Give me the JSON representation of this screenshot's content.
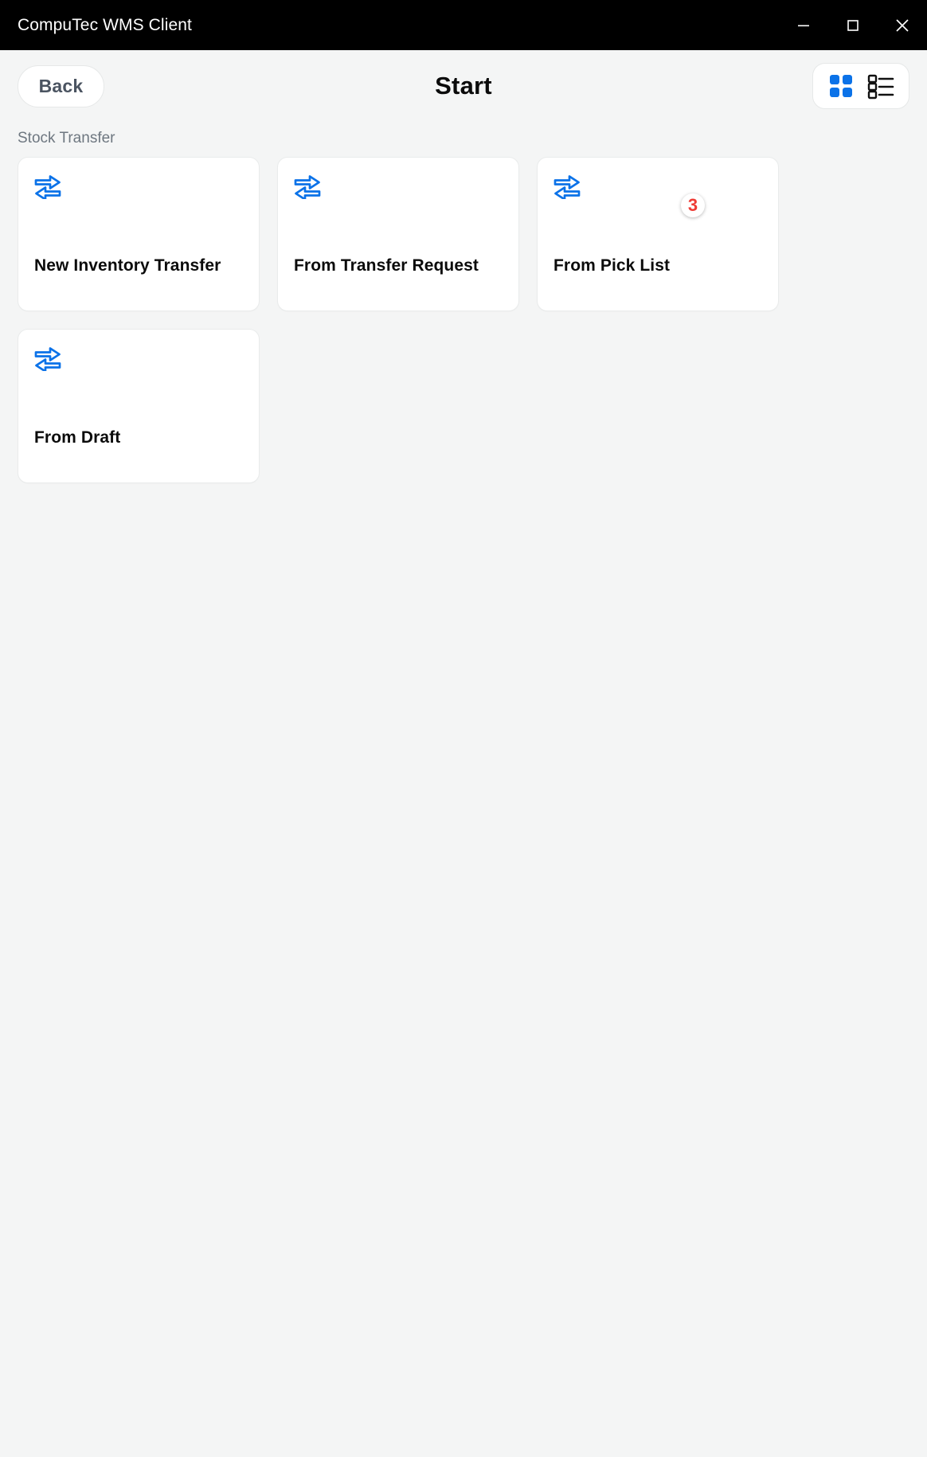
{
  "window": {
    "title": "CompuTec WMS Client",
    "controls": [
      {
        "name": "minimize",
        "icon": "minimize-icon"
      },
      {
        "name": "maximize",
        "icon": "maximize-icon"
      },
      {
        "name": "close",
        "icon": "close-icon"
      }
    ]
  },
  "header": {
    "back_label": "Back",
    "title": "Start",
    "view_toggle": {
      "grid_icon": "grid-view-icon",
      "list_icon": "list-view-icon",
      "active": "grid",
      "active_color": "#0b72e8",
      "inactive_color": "#111111"
    }
  },
  "section": {
    "label": "Stock Transfer"
  },
  "cards": [
    {
      "label": "New Inventory Transfer",
      "icon": "transfer-arrows-icon",
      "icon_color": "#0b72e8",
      "badge": null
    },
    {
      "label": "From Transfer Request",
      "icon": "transfer-arrows-icon",
      "icon_color": "#0b72e8",
      "badge": null
    },
    {
      "label": "From Pick List",
      "icon": "transfer-arrows-icon",
      "icon_color": "#0b72e8",
      "badge": "3",
      "badge_color": "#ee3b35"
    },
    {
      "label": "From Draft",
      "icon": "transfer-arrows-icon",
      "icon_color": "#0b72e8",
      "badge": null
    }
  ],
  "theme": {
    "titlebar_bg": "#000000",
    "page_bg": "#f4f5f5",
    "card_bg": "#ffffff",
    "accent": "#0b72e8",
    "muted_text": "#6e7780"
  }
}
